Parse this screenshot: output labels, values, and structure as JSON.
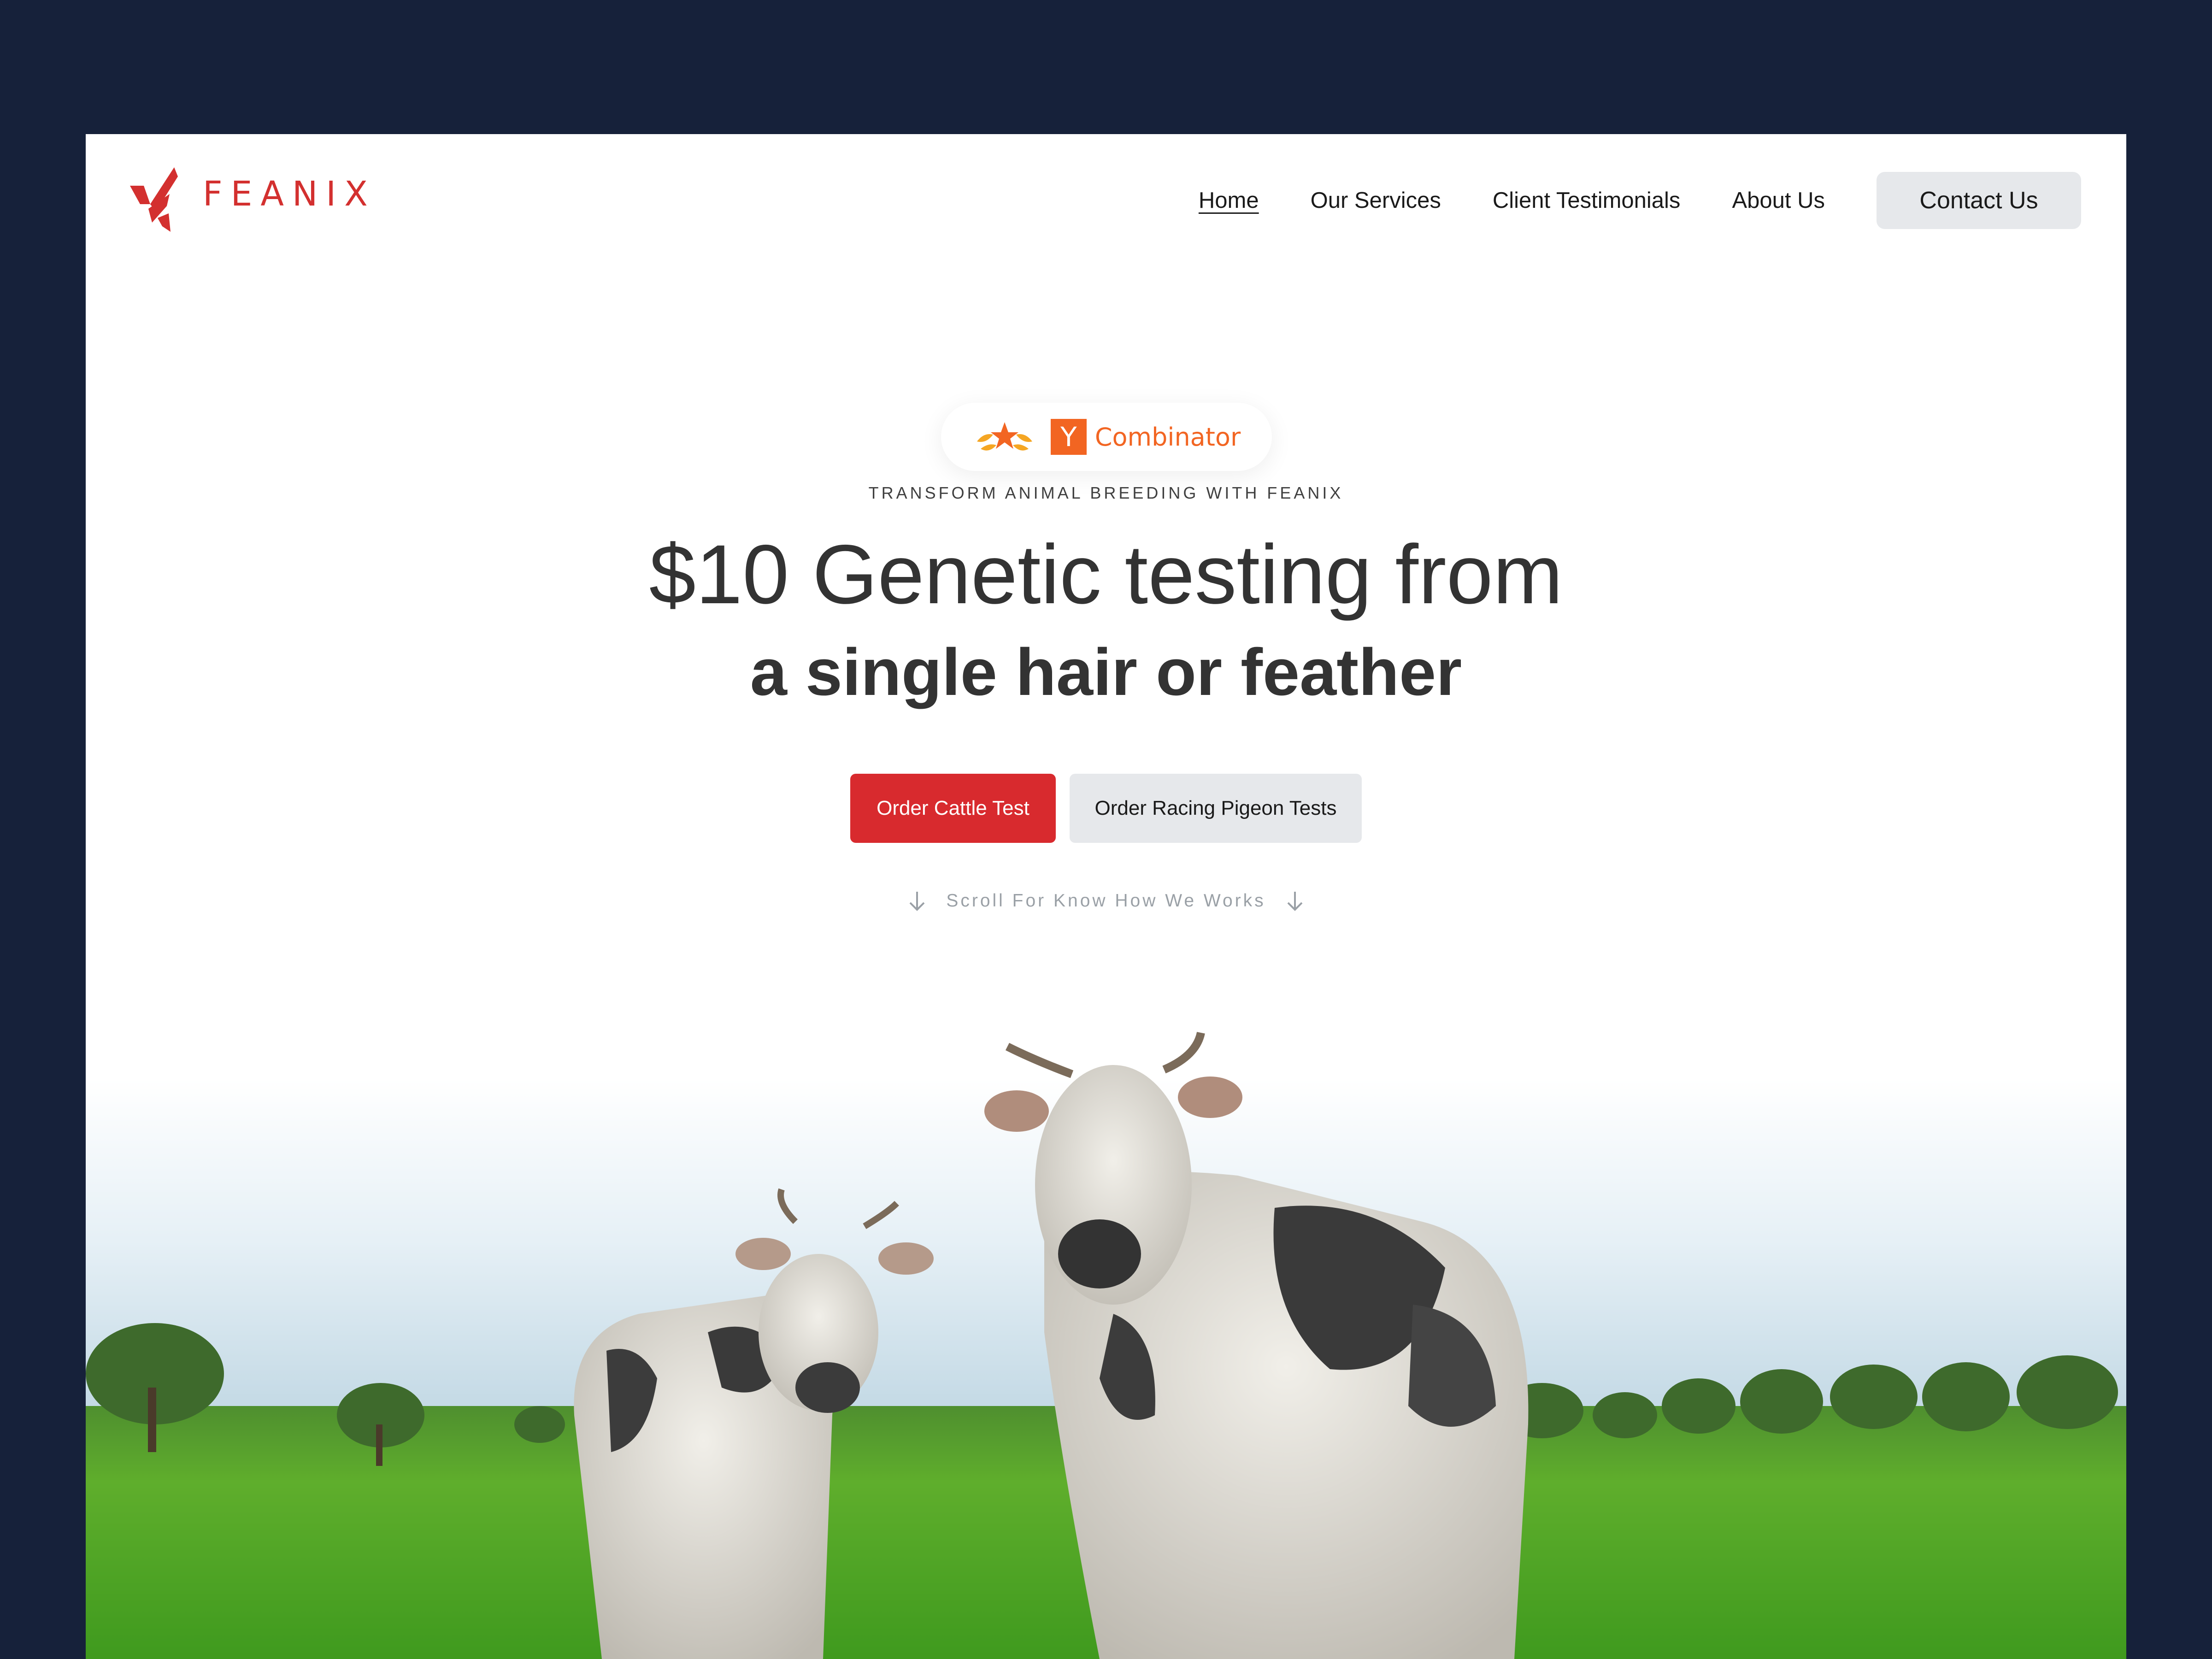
{
  "brand": {
    "name": "FEANIX",
    "color": "#d3302f",
    "logo_icon": "feanix-logo-icon"
  },
  "nav": {
    "items": [
      {
        "label": "Home",
        "active": true
      },
      {
        "label": "Our Services",
        "active": false
      },
      {
        "label": "Client Testimonials",
        "active": false
      },
      {
        "label": "About Us",
        "active": false
      }
    ],
    "contact_label": "Contact Us"
  },
  "badge": {
    "icon": "laurel-star-icon",
    "yc_letter": "Y",
    "yc_name": "Combinator",
    "yc_color": "#f26522"
  },
  "hero": {
    "eyebrow": "TRANSFORM ANIMAL BREEDING WITH FEANIX",
    "headline_line1": "$10 Genetic testing from",
    "headline_line2": "a single hair or feather",
    "primary_cta": "Order Cattle Test",
    "secondary_cta": "Order Racing Pigeon Tests",
    "scroll_hint": "Scroll For Know How We Works"
  },
  "colors": {
    "page_bg": "#16213a",
    "primary": "#d82a2e",
    "secondary_btn": "#e6e8eb"
  }
}
